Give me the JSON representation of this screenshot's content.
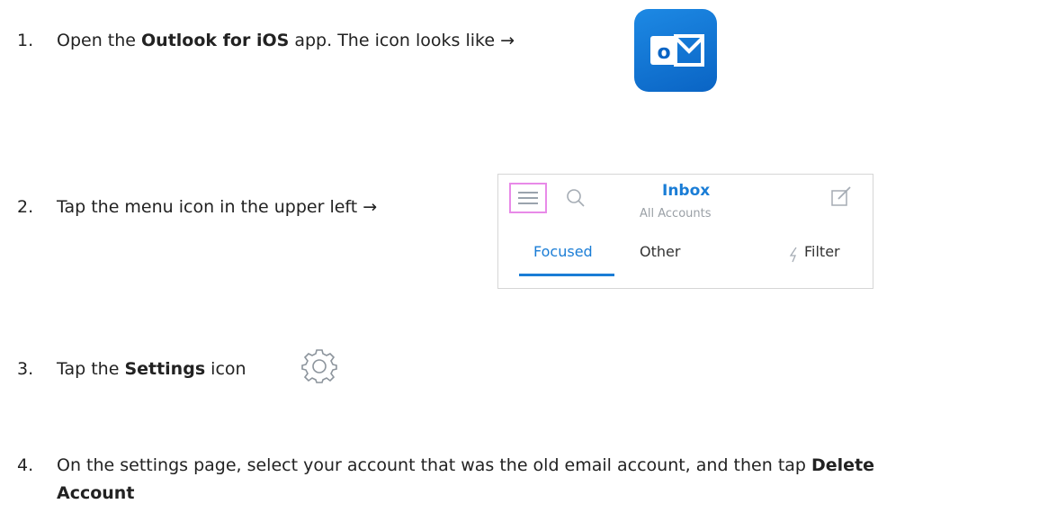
{
  "steps": [
    {
      "num": "1.",
      "pre": "Open the ",
      "bold": "Outlook for iOS",
      "post": " app. The icon looks like →",
      "icon": "outlook-app-icon",
      "icon_letter": "o"
    },
    {
      "num": "2.",
      "text": "Tap the menu icon in the upper left →",
      "screenshot": {
        "title": "Inbox",
        "subtitle": "All Accounts",
        "tabs": [
          "Focused",
          "Other"
        ],
        "filter_label": "Filter",
        "active_tab": "Focused",
        "highlight_color": "#e88ae8",
        "accent_color": "#1a7dd6",
        "icons": [
          "menu-icon",
          "search-icon",
          "compose-icon",
          "filter-icon"
        ]
      }
    },
    {
      "num": "3.",
      "pre": "Tap the ",
      "bold": "Settings",
      "post": " icon",
      "icon": "gear-icon"
    },
    {
      "num": "4.",
      "pre": "On the settings page, select your account that was the old email account, and then tap ",
      "bold": "Delete",
      "line2_bold": "Account"
    }
  ]
}
